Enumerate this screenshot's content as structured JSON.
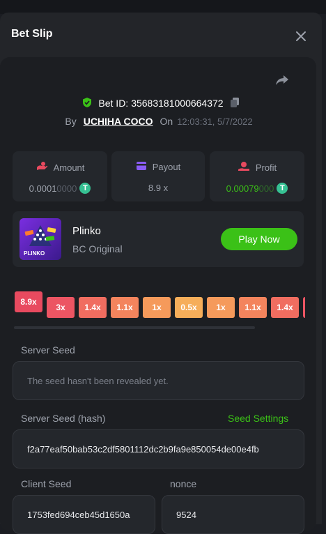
{
  "modal": {
    "title": "Bet Slip"
  },
  "bet": {
    "id_label": "Bet ID:",
    "id_value": "35683181000664372",
    "by_label": "By",
    "user": "UCHIHA COCO",
    "on_label": "On",
    "datetime": "12:03:31, 5/7/2022"
  },
  "stats": {
    "amount": {
      "label": "Amount",
      "value_main": "0.0001",
      "value_faded": "0000"
    },
    "payout": {
      "label": "Payout",
      "value": "8.9 x"
    },
    "profit": {
      "label": "Profit",
      "value_main": "0.00079",
      "value_faded": "000"
    }
  },
  "game": {
    "name": "Plinko",
    "subtitle": "BC Original",
    "play_label": "Play Now",
    "thumb_text": "PLINKO"
  },
  "multipliers": [
    "8.9x",
    "3x",
    "1.4x",
    "1.1x",
    "1x",
    "0.5x",
    "1x",
    "1.1x",
    "1.4x"
  ],
  "seeds": {
    "server_seed_label": "Server Seed",
    "server_seed_value": "The seed hasn't been revealed yet.",
    "server_hash_label": "Server Seed (hash)",
    "seed_settings_label": "Seed Settings",
    "server_hash_value": "f2a77eaf50bab53c2df5801112dc2b9fa9e850054de00e4fb",
    "client_seed_label": "Client Seed",
    "client_seed_value": "1753fed694ceb45d1650a",
    "nonce_label": "nonce",
    "nonce_value": "9524"
  },
  "colors": {
    "accent_green": "#3bc117",
    "coin": "#36c193",
    "multiplier_high": "#e84a5f",
    "multiplier_mid": "#f36c5f",
    "multiplier_low": "#f5a45c"
  }
}
